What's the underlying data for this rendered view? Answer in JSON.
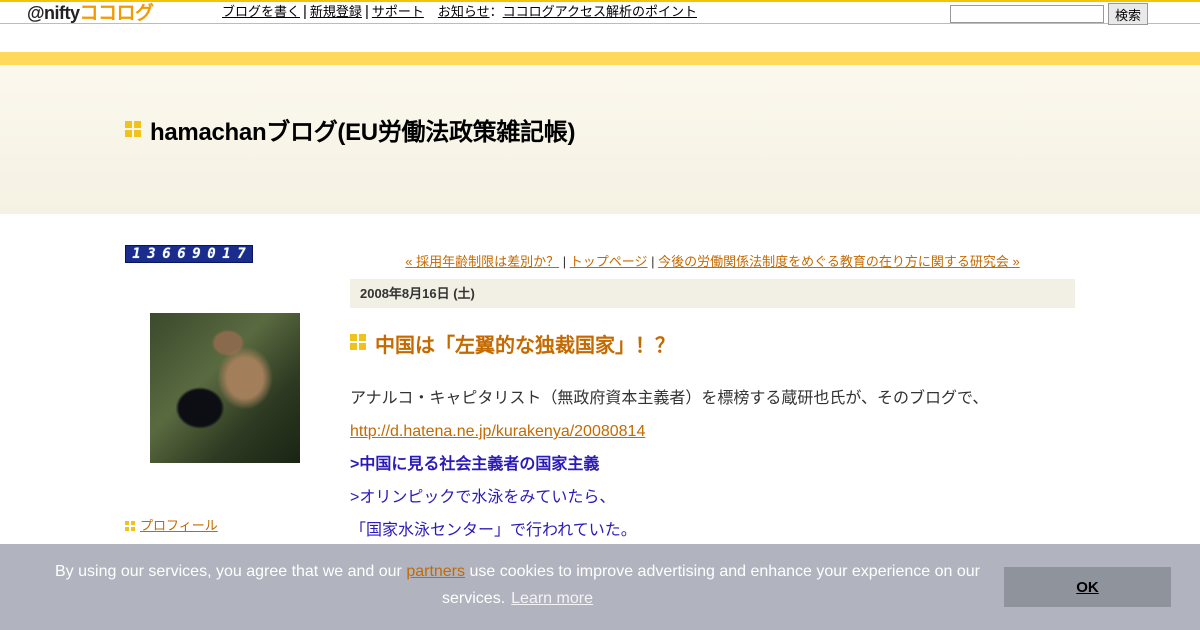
{
  "topbar": {
    "logo_prefix": "@nifty",
    "logo_brand": "ココログ",
    "nav": [
      {
        "label": "ブログを書く"
      },
      {
        "label": "新規登録"
      },
      {
        "label": "サポート"
      }
    ],
    "news_label": "お知らせ",
    "news_colon": "：",
    "news_link": "ココログアクセス解析のポイント",
    "search_placeholder": "",
    "search_button": "検索"
  },
  "header": {
    "blog_title": "hamachanブログ(EU労働法政策雑記帳)"
  },
  "sidebar": {
    "access_count": "13669017",
    "profile_link": "プロフィール"
  },
  "entry_nav": {
    "prev": "« 採用年齢制限は差別か？",
    "separator": " | ",
    "home": "トップページ",
    "next": "今後の労働関係法制度をめぐる教育の在り方に関する研究会 »"
  },
  "entry": {
    "date": "2008年8月16日 (土)",
    "title": "中国は「左翼的な独裁国家」！？",
    "body_line_1": "アナルコ・キャピタリスト（無政府資本主義者）を標榜する蔵研也氏が、そのブログで、",
    "link": "http://d.hatena.ne.jp/kurakenya/20080814",
    "quote_heading": ">中国に見る社会主義者の国家主義",
    "quote_line_1": ">オリンピックで水泳をみていたら、",
    "quote_line_2": "「国家水泳センター」で行われていた。"
  },
  "cookie_banner": {
    "text_before": "By using our services, you agree that we and our ",
    "partners_link": "partners",
    "text_after": " use cookies to improve advertising and enhance your experience on our services.",
    "learn_more": "Learn more",
    "ok_button": "OK"
  },
  "colors": {
    "accent_orange": "#c46a00",
    "quote_blue": "#2a1ab8",
    "header_yellow": "#ffd95a",
    "icon_yellow": "#f0c21a",
    "banner_gray": "#b1b4be"
  }
}
